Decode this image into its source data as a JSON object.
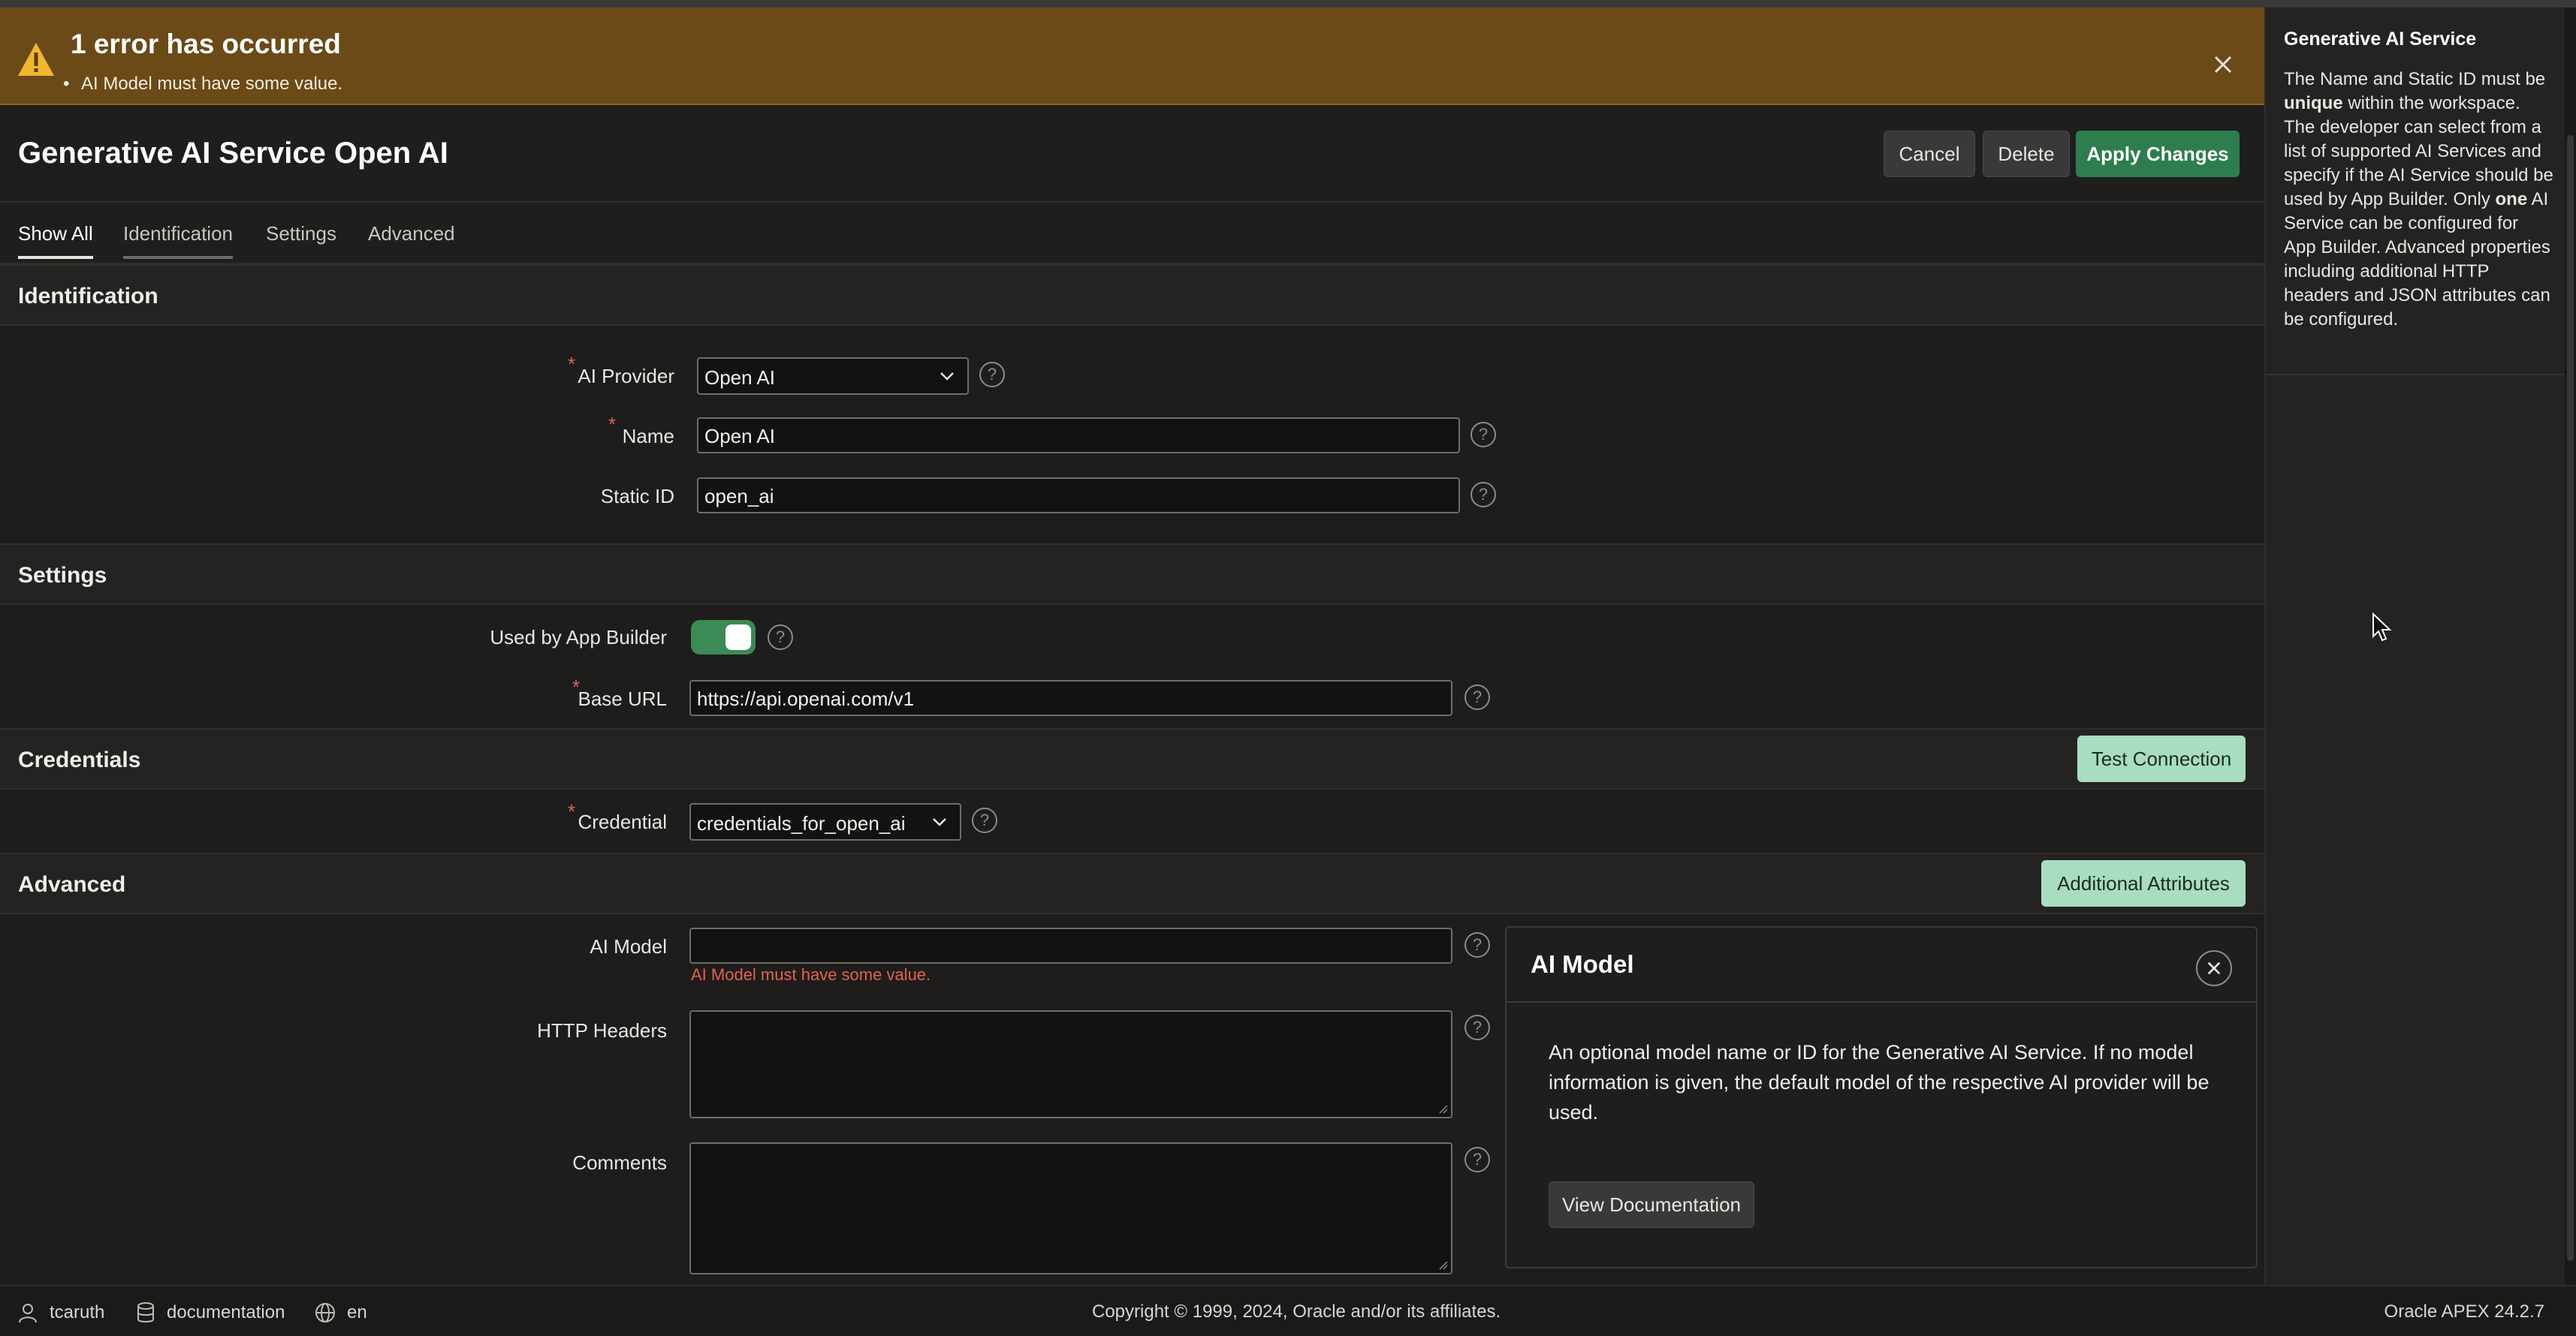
{
  "banner": {
    "title": "1 error has occurred",
    "message": "AI Model must have some value."
  },
  "page": {
    "title": "Generative AI Service Open AI"
  },
  "toolbar": {
    "cancel_label": "Cancel",
    "delete_label": "Delete",
    "apply_label": "Apply Changes"
  },
  "tabs": [
    {
      "label": "Show All"
    },
    {
      "label": "Identification"
    },
    {
      "label": "Settings"
    },
    {
      "label": "Advanced"
    }
  ],
  "identification": {
    "heading": "Identification",
    "ai_provider_label": "AI Provider",
    "ai_provider_value": "Open AI",
    "name_label": "Name",
    "name_value": "Open AI",
    "static_id_label": "Static ID",
    "static_id_value": "open_ai"
  },
  "settings": {
    "heading": "Settings",
    "used_by_app_builder_label": "Used by App Builder",
    "used_by_app_builder": true,
    "base_url_label": "Base URL",
    "base_url_value": "https://api.openai.com/v1"
  },
  "credentials": {
    "heading": "Credentials",
    "test_connection_label": "Test Connection",
    "credential_label": "Credential",
    "credential_value": "credentials_for_open_ai"
  },
  "advanced": {
    "heading": "Advanced",
    "additional_attributes_label": "Additional Attributes",
    "ai_model_label": "AI Model",
    "ai_model_value": "",
    "ai_model_error": "AI Model must have some value.",
    "http_headers_label": "HTTP Headers",
    "comments_label": "Comments"
  },
  "help_popup": {
    "title": "AI Model",
    "body": "An optional model name or ID for the Generative AI Service. If no model information is given, the default model of the respective AI provider will be used.",
    "doc_button_label": "View Documentation"
  },
  "side_panel": {
    "title": "Generative AI Service",
    "p1": "The Name and Static ID must be ",
    "b1": "unique",
    "p2": " within the workspace. The developer can select from a list of supported AI Services and specify if the AI Service should be used by App Builder. Only ",
    "b2": "one",
    "p3": " AI Service can be configured for App Builder. Advanced properties including additional HTTP headers and JSON attributes can be configured."
  },
  "footer": {
    "user": "tcaruth",
    "workspace": "documentation",
    "language": "en",
    "copyright": "Copyright © 1999, 2024, Oracle and/or its affiliates.",
    "version": "Oracle APEX 24.2.7"
  },
  "colors": {
    "banner_bg": "#6b4a18",
    "apply_green": "#2e7d4f",
    "mint_button": "#a8ddc1",
    "error_red": "#e4604f",
    "toggle_on": "#3c8a55"
  },
  "icons": [
    "warning-icon",
    "close-icon",
    "chevron-down-icon",
    "help-icon",
    "user-icon",
    "database-icon",
    "globe-icon"
  ]
}
